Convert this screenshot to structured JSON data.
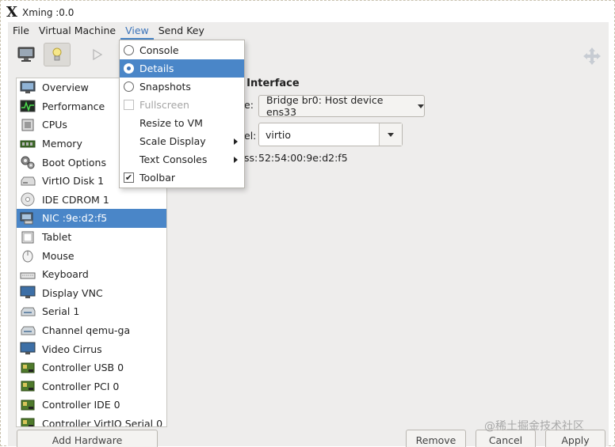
{
  "window": {
    "title": "Xming :0.0"
  },
  "menubar": {
    "items": [
      "File",
      "Virtual Machine",
      "View",
      "Send Key"
    ],
    "active_index": 2
  },
  "view_menu": {
    "items": [
      {
        "label": "Console",
        "type": "radio",
        "checked": false,
        "enabled": true
      },
      {
        "label": "Details",
        "type": "radio",
        "checked": true,
        "enabled": true,
        "highlighted": true
      },
      {
        "label": "Snapshots",
        "type": "radio",
        "checked": false,
        "enabled": true
      },
      {
        "label": "Fullscreen",
        "type": "check",
        "checked": false,
        "enabled": false
      },
      {
        "label": "Resize to VM",
        "type": "plain",
        "enabled": true
      },
      {
        "label": "Scale Display",
        "type": "submenu",
        "enabled": true
      },
      {
        "label": "Text Consoles",
        "type": "submenu",
        "enabled": true
      },
      {
        "label": "Toolbar",
        "type": "check",
        "checked": true,
        "enabled": true
      }
    ],
    "check_mark": "✔"
  },
  "sidebar": {
    "items": [
      {
        "label": "Overview",
        "icon": "monitor-icon"
      },
      {
        "label": "Performance",
        "icon": "performance-icon"
      },
      {
        "label": "CPUs",
        "icon": "cpu-icon"
      },
      {
        "label": "Memory",
        "icon": "memory-icon"
      },
      {
        "label": "Boot Options",
        "icon": "gears-icon"
      },
      {
        "label": "VirtIO Disk 1",
        "icon": "disk-icon"
      },
      {
        "label": "IDE CDROM 1",
        "icon": "cdrom-icon"
      },
      {
        "label": "NIC :9e:d2:f5",
        "icon": "nic-icon",
        "selected": true
      },
      {
        "label": "Tablet",
        "icon": "tablet-icon"
      },
      {
        "label": "Mouse",
        "icon": "mouse-icon"
      },
      {
        "label": "Keyboard",
        "icon": "keyboard-icon"
      },
      {
        "label": "Display VNC",
        "icon": "display-icon"
      },
      {
        "label": "Serial 1",
        "icon": "serial-icon"
      },
      {
        "label": "Channel qemu-ga",
        "icon": "channel-icon"
      },
      {
        "label": "Video Cirrus",
        "icon": "video-icon"
      },
      {
        "label": "Controller USB 0",
        "icon": "controller-icon"
      },
      {
        "label": "Controller PCI 0",
        "icon": "controller-icon"
      },
      {
        "label": "Controller IDE 0",
        "icon": "controller-icon"
      },
      {
        "label": "Controller VirtIO Serial 0",
        "icon": "controller-icon"
      }
    ]
  },
  "details": {
    "section_title": "k Interface",
    "source_label": "e:",
    "source_value": "Bridge br0: Host device ens33",
    "model_label": "el:",
    "model_value": "virtio",
    "mac_label": "ss:",
    "mac_value": "52:54:00:9e:d2:f5"
  },
  "buttons": {
    "add_hardware": "Add Hardware",
    "remove": "Remove",
    "cancel": "Cancel",
    "apply": "Apply"
  },
  "watermark": "@稀土掘金技术社区",
  "colors": {
    "accent": "#4a86c8",
    "selection_text": "#ffffff",
    "window_bg": "#eeedec"
  }
}
